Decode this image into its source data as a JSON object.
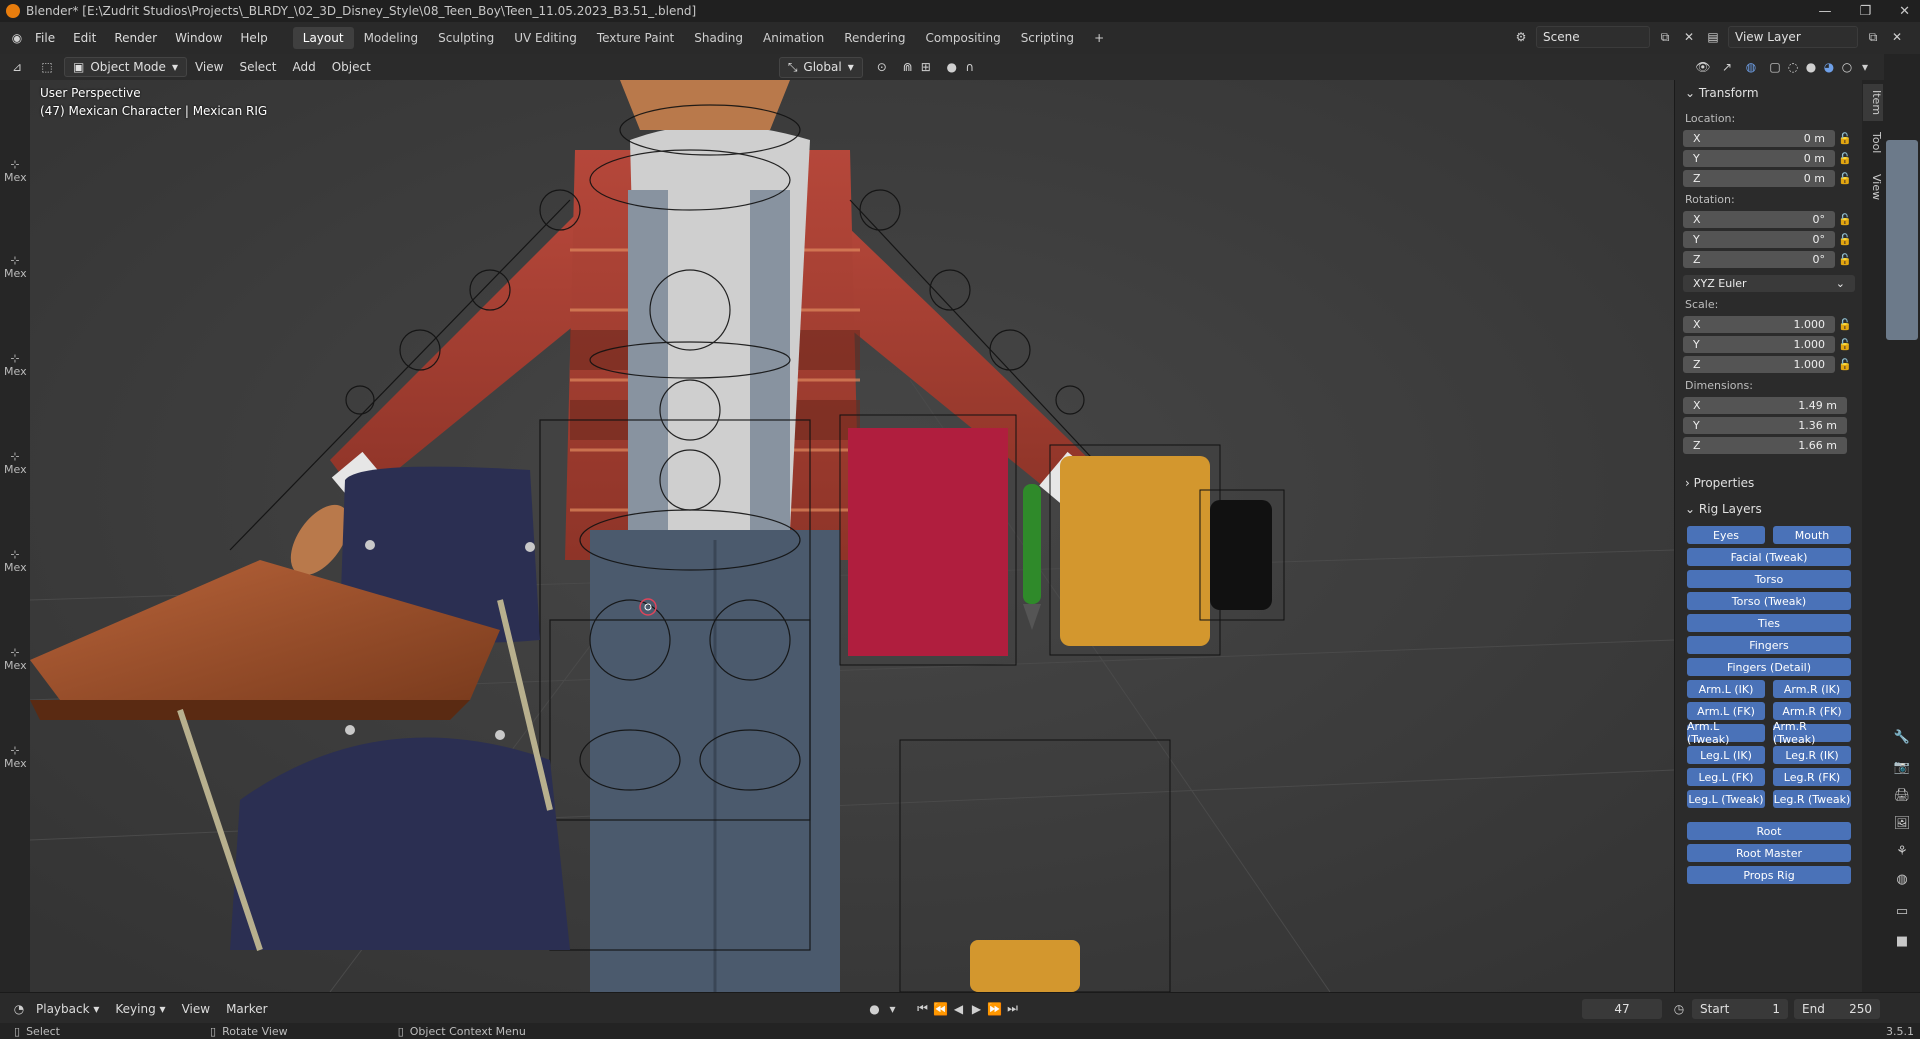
{
  "titlebar": {
    "title": "Blender* [E:\\Zudrit Studios\\Projects\\_BLRDY_\\02_3D_Disney_Style\\08_Teen_Boy\\Teen_11.05.2023_B3.51_.blend]",
    "minimize": "—",
    "maximize": "❐",
    "close": "✕"
  },
  "menu": {
    "items": [
      "File",
      "Edit",
      "Render",
      "Window",
      "Help"
    ],
    "workspaces": [
      "Layout",
      "Modeling",
      "Sculpting",
      "UV Editing",
      "Texture Paint",
      "Shading",
      "Animation",
      "Rendering",
      "Compositing",
      "Scripting"
    ],
    "active_workspace": "Layout",
    "add_tab": "+",
    "scene_label": "Scene",
    "view_layer_label": "View Layer"
  },
  "viewport_header": {
    "mode": "Object Mode",
    "menus": [
      "View",
      "Select",
      "Add",
      "Object"
    ],
    "orientation": "Global"
  },
  "viewport": {
    "perspective": "User Perspective",
    "object_info": "(47) Mexican Character | Mexican RIG"
  },
  "toolstrip": {
    "labels": [
      "Mex",
      "Mex",
      "Mex",
      "Mex",
      "Mex",
      "Mex",
      "Mex"
    ]
  },
  "npanel": {
    "transform_title": "Transform",
    "location_label": "Location:",
    "location": [
      {
        "axis": "X",
        "value": "0 m"
      },
      {
        "axis": "Y",
        "value": "0 m"
      },
      {
        "axis": "Z",
        "value": "0 m"
      }
    ],
    "rotation_label": "Rotation:",
    "rotation": [
      {
        "axis": "X",
        "value": "0°"
      },
      {
        "axis": "Y",
        "value": "0°"
      },
      {
        "axis": "Z",
        "value": "0°"
      }
    ],
    "rotation_mode": "XYZ Euler",
    "scale_label": "Scale:",
    "scale": [
      {
        "axis": "X",
        "value": "1.000"
      },
      {
        "axis": "Y",
        "value": "1.000"
      },
      {
        "axis": "Z",
        "value": "1.000"
      }
    ],
    "dimensions_label": "Dimensions:",
    "dimensions": [
      {
        "axis": "X",
        "value": "1.49 m"
      },
      {
        "axis": "Y",
        "value": "1.36 m"
      },
      {
        "axis": "Z",
        "value": "1.66 m"
      }
    ],
    "properties_title": "Properties",
    "rig_layers_title": "Rig Layers",
    "rig": {
      "eyes": "Eyes",
      "mouth": "Mouth",
      "facial_tweak": "Facial (Tweak)",
      "torso": "Torso",
      "torso_tweak": "Torso (Tweak)",
      "ties": "Ties",
      "fingers": "Fingers",
      "fingers_detail": "Fingers (Detail)",
      "arm_l_ik": "Arm.L (IK)",
      "arm_r_ik": "Arm.R (IK)",
      "arm_l_fk": "Arm.L (FK)",
      "arm_r_fk": "Arm.R (FK)",
      "arm_l_tweak": "Arm.L (Tweak)",
      "arm_r_tweak": "Arm.R (Tweak)",
      "leg_l_ik": "Leg.L (IK)",
      "leg_r_ik": "Leg.R (IK)",
      "leg_l_fk": "Leg.L (FK)",
      "leg_r_fk": "Leg.R (FK)",
      "leg_l_tweak": "Leg.L (Tweak)",
      "leg_r_tweak": "Leg.R (Tweak)",
      "root": "Root",
      "root_master": "Root Master",
      "props_rig": "Props Rig"
    }
  },
  "sidetabs": [
    "Item",
    "Tool",
    "View"
  ],
  "timeline": {
    "playback": "Playback",
    "keying": "Keying",
    "view": "View",
    "marker": "Marker",
    "current_frame": "47",
    "start_label": "Start",
    "start_value": "1",
    "end_label": "End",
    "end_value": "250"
  },
  "statusbar": {
    "select": "Select",
    "rotate_view": "Rotate View",
    "context_menu": "Object Context Menu",
    "version": "3.5.1"
  },
  "colors": {
    "accent": "#4a72b8",
    "viewport_bg": "#3d3d3d",
    "panel_bg": "#2b2b2b"
  }
}
